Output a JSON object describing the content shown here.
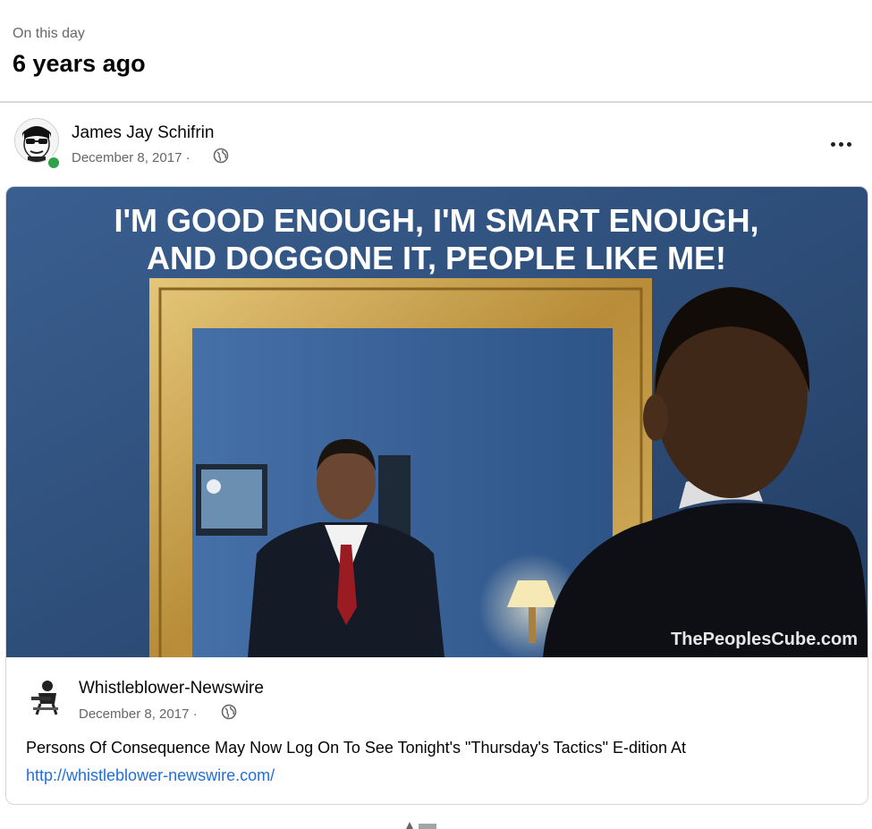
{
  "memory": {
    "label": "On this day",
    "years_ago": "6 years ago"
  },
  "post": {
    "author": "James Jay Schifrin",
    "date": "December 8, 2017 ·",
    "privacy_icon": "globe-icon",
    "more_icon": "more-options-icon"
  },
  "image": {
    "headline_line1": "I'M GOOD ENOUGH, I'M SMART ENOUGH,",
    "headline_line2": "AND DOGGONE IT, PEOPLE LIKE ME!",
    "watermark": "ThePeoplesCube.com"
  },
  "shared": {
    "page_name": "Whistleblower-Newswire",
    "date": "December 8, 2017 ·",
    "text": "Persons Of Consequence May Now Log On To See Tonight's \"Thursday's Tactics\" E-dition At",
    "link": "http://whistleblower-newswire.com/"
  },
  "colors": {
    "link": "#216fdb",
    "online": "#31a24c",
    "wall": "#2f4f7a",
    "frame": "#c9a24a"
  }
}
